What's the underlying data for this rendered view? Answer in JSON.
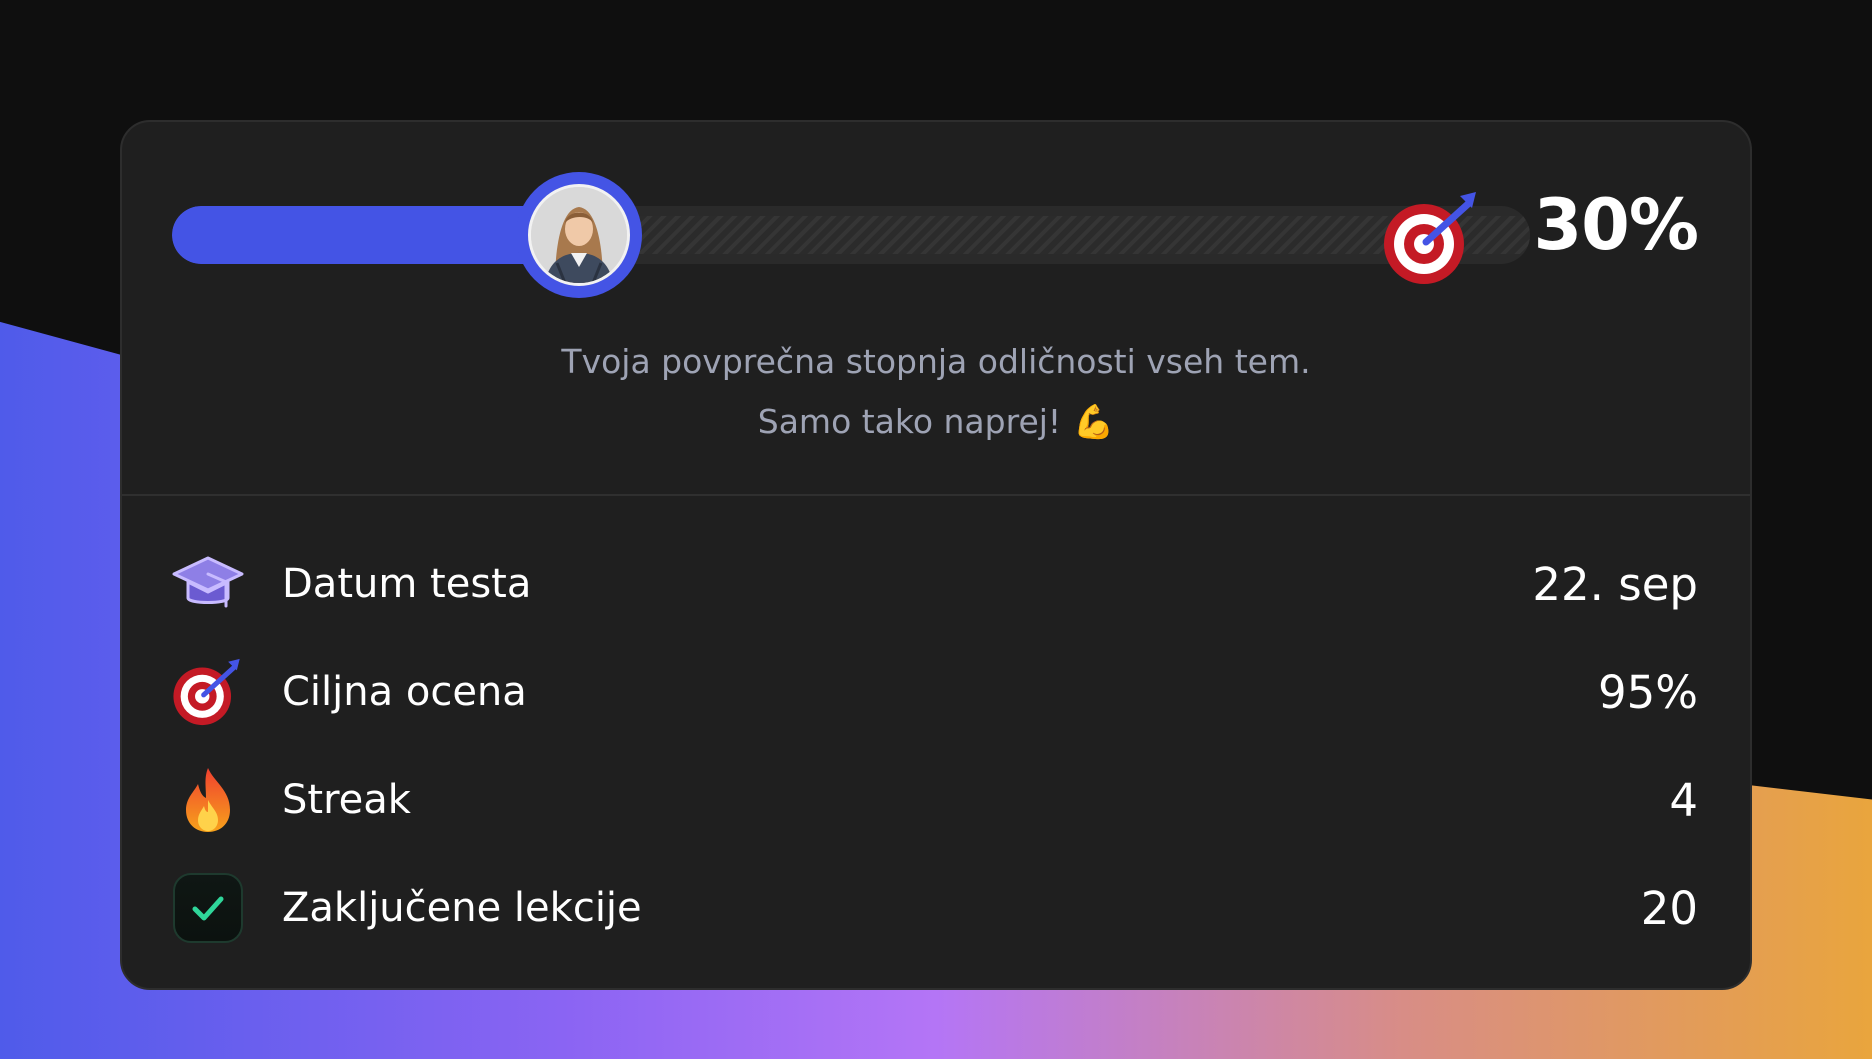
{
  "progress": {
    "percent_label": "30%",
    "fraction": 0.3
  },
  "subtitle": {
    "line1": "Tvoja povprečna stopnja odličnosti vseh tem.",
    "line2": "Samo tako naprej!",
    "emoji": "💪"
  },
  "stats": [
    {
      "icon": "graduation-cap-icon",
      "label": "Datum testa",
      "value": "22. sep"
    },
    {
      "icon": "target-icon",
      "label": "Ciljna ocena",
      "value": "95%"
    },
    {
      "icon": "fire-icon",
      "label": "Streak",
      "value": "4"
    },
    {
      "icon": "checkmark-icon",
      "label": "Zaključene lekcije",
      "value": "20"
    }
  ],
  "colors": {
    "accent": "#4454e5",
    "card": "#1f1f1f",
    "subtext": "#9ea3b4",
    "check": "#2fd69a"
  }
}
